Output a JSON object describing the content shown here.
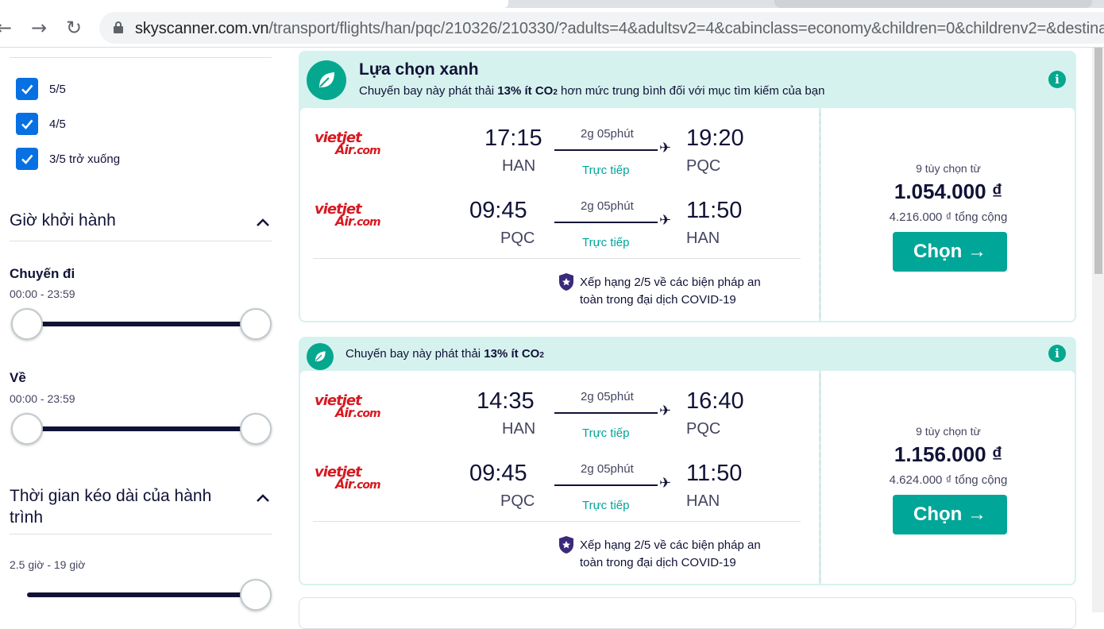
{
  "browser": {
    "url_host": "skyscanner.com.vn",
    "url_path": "/transport/flights/han/pqc/210326/210330/?adults=4&adultsv2=4&cabinclass=economy&children=0&childrenv2=&destinat"
  },
  "sidebar": {
    "ratings": [
      {
        "label": "5/5",
        "checked": true
      },
      {
        "label": "4/5",
        "checked": true
      },
      {
        "label": "3/5 trở xuống",
        "checked": true
      }
    ],
    "departure_time": {
      "title": "Giờ khởi hành",
      "outbound_label": "Chuyến đi",
      "outbound_range": "00:00 - 23:59",
      "return_label": "Về",
      "return_range": "00:00 - 23:59"
    },
    "duration": {
      "title": "Thời gian kéo dài của hành trình",
      "range": "2.5 giờ - 19 giờ"
    }
  },
  "results": [
    {
      "banner_title": "Lựa chọn xanh",
      "banner_text_pre": "Chuyến bay này phát thải ",
      "banner_text_bold": "13% ít CO",
      "banner_text_sub": "2",
      "banner_text_post": " hơn mức trung bình đối với mục tìm kiếm của bạn",
      "legs": [
        {
          "airline_l1": "vietjet",
          "airline_l2": "Air",
          "airline_l3": ".com",
          "depart_time": "17:15",
          "depart_code": "HAN",
          "duration": "2g 05phút",
          "stops": "Trực tiếp",
          "arrive_time": "19:20",
          "arrive_code": "PQC"
        },
        {
          "airline_l1": "vietjet",
          "airline_l2": "Air",
          "airline_l3": ".com",
          "depart_time": "09:45",
          "depart_code": "PQC",
          "duration": "2g 05phút",
          "stops": "Trực tiếp",
          "arrive_time": "11:50",
          "arrive_code": "HAN"
        }
      ],
      "covid_line1": "Xếp hạng 2/5 về các biện pháp an",
      "covid_line2": "toàn trong đại dịch COVID-19",
      "options": "9 tùy chọn từ",
      "price": "1.054.000 ₫",
      "total": "4.216.000 ₫ tổng cộng",
      "button": "Chọn →"
    },
    {
      "banner_text_pre": "Chuyến bay này phát thải ",
      "banner_text_bold": "13% ít CO",
      "banner_text_sub": "2",
      "legs": [
        {
          "airline_l1": "vietjet",
          "airline_l2": "Air",
          "airline_l3": ".com",
          "depart_time": "14:35",
          "depart_code": "HAN",
          "duration": "2g 05phút",
          "stops": "Trực tiếp",
          "arrive_time": "16:40",
          "arrive_code": "PQC"
        },
        {
          "airline_l1": "vietjet",
          "airline_l2": "Air",
          "airline_l3": ".com",
          "depart_time": "09:45",
          "depart_code": "PQC",
          "duration": "2g 05phút",
          "stops": "Trực tiếp",
          "arrive_time": "11:50",
          "arrive_code": "HAN"
        }
      ],
      "covid_line1": "Xếp hạng 2/5 về các biện pháp an",
      "covid_line2": "toàn trong đại dịch COVID-19",
      "options": "9 tùy chọn từ",
      "price": "1.156.000 ₫",
      "total": "4.624.000 ₫ tổng cộng",
      "button": "Chọn →"
    }
  ],
  "colors": {
    "accent": "#00a698",
    "checkbox": "#0770e3",
    "airline": "#d71921",
    "banner_bg": "#d6f2ef"
  }
}
